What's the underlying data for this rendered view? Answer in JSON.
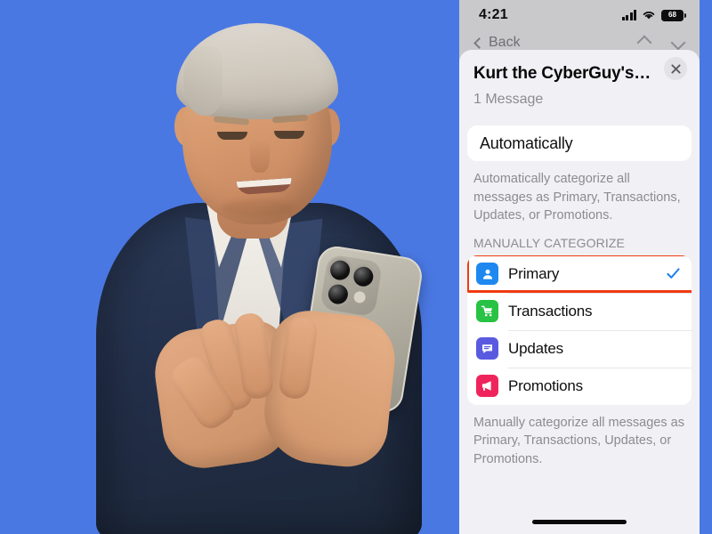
{
  "background": {
    "color": "#4a78e3"
  },
  "photo": {
    "subject_alt": "Man in navy suit and white shirt holding an iPhone Pro",
    "device_alt": "iPhone Pro with triple rear camera"
  },
  "phone": {
    "status_bar": {
      "time": "4:21",
      "cellular_icon": "signal-bars-icon",
      "wifi_icon": "wifi-icon",
      "battery_level": "68",
      "battery_icon": "battery-icon"
    },
    "nav": {
      "back_label": "Back",
      "back_icon": "chevron-left-icon",
      "up_icon": "chevron-up-icon",
      "down_icon": "chevron-down-icon"
    },
    "sheet": {
      "title": "Kurt the CyberGuy's…",
      "subtitle": "1 Message",
      "close_icon": "close-icon",
      "automatic_option": {
        "label": "Automatically",
        "description": "Automatically categorize all messages as Primary, Transactions, Updates, or Promotions."
      },
      "manual_section": {
        "header": "MANUALLY CATEGORIZE",
        "description": "Manually categorize all messages as Primary, Transactions, Updates, or Promotions.",
        "items": [
          {
            "label": "Primary",
            "icon": "person-icon",
            "color": "#1e88f0",
            "selected": true,
            "check_icon": "checkmark-icon"
          },
          {
            "label": "Transactions",
            "icon": "cart-icon",
            "color": "#28c244",
            "selected": false,
            "check_icon": ""
          },
          {
            "label": "Updates",
            "icon": "chat-icon",
            "color": "#5a5ae0",
            "selected": false,
            "check_icon": ""
          },
          {
            "label": "Promotions",
            "icon": "megaphone-icon",
            "color": "#f0245c",
            "selected": false,
            "check_icon": ""
          }
        ]
      }
    },
    "home_indicator": "home-indicator"
  },
  "annotation": {
    "highlight_color": "#ef3a11",
    "target": "Primary"
  }
}
